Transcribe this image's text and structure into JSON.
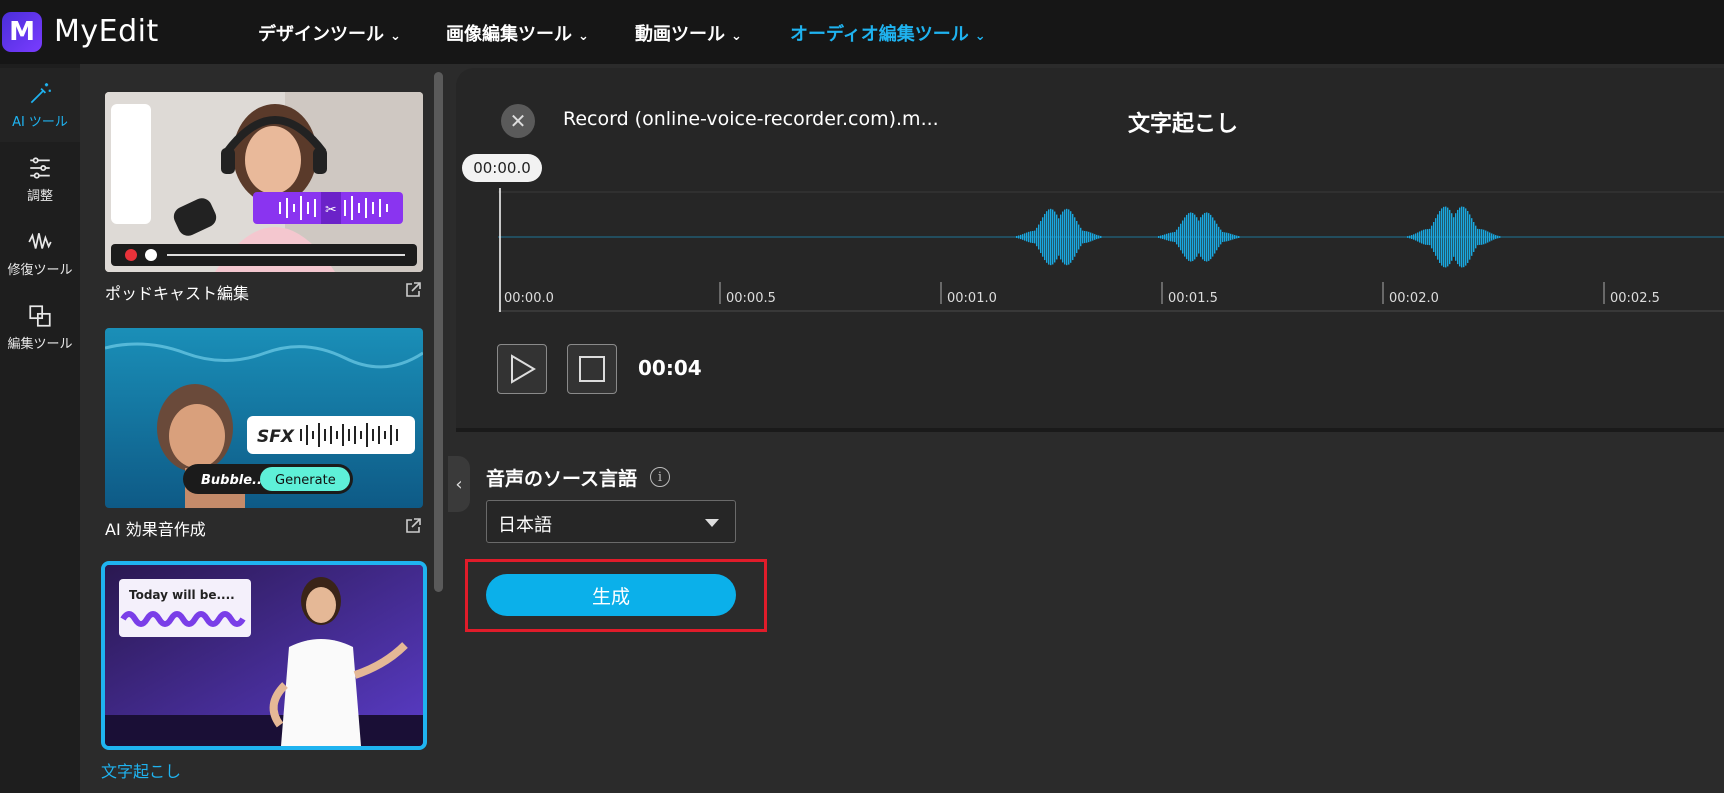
{
  "app": {
    "logo_letter": "M",
    "brand": "MyEdit"
  },
  "nav": [
    {
      "label": "デザインツール"
    },
    {
      "label": "画像編集ツール"
    },
    {
      "label": "動画ツール"
    },
    {
      "label": "オーディオ編集ツール",
      "active": true
    }
  ],
  "rail": [
    {
      "label": "AI ツール",
      "icon": "magic-wand-icon",
      "active": true
    },
    {
      "label": "調整",
      "icon": "sliders-icon"
    },
    {
      "label": "修復ツール",
      "icon": "waveform-repair-icon"
    },
    {
      "label": "編集ツール",
      "icon": "layers-icon"
    }
  ],
  "tools": [
    {
      "title": "ポッドキャスト編集",
      "mini_label": ""
    },
    {
      "title": "AI 効果音作成",
      "sfx": "SFX",
      "bubble": "Bubble...",
      "generate": "Generate"
    },
    {
      "title": "文字起こし",
      "caption": "Today will be....",
      "active": true
    }
  ],
  "editor": {
    "file_name": "Record (online-voice-recorder.com).m...",
    "title": "文字起こし",
    "playhead_time": "00:00.0",
    "ruler": [
      "00:00.0",
      "00:00.5",
      "00:01.0",
      "00:01.5",
      "00:02.0",
      "00:02.5"
    ],
    "elapsed": "00:04"
  },
  "settings": {
    "source_language_label": "音声のソース言語",
    "info_glyph": "i",
    "language_value": "日本語",
    "generate_label": "生成"
  },
  "colors": {
    "accent": "#1fb3f0",
    "waveform": "#1aa8e0",
    "highlight": "#e01c2a"
  }
}
